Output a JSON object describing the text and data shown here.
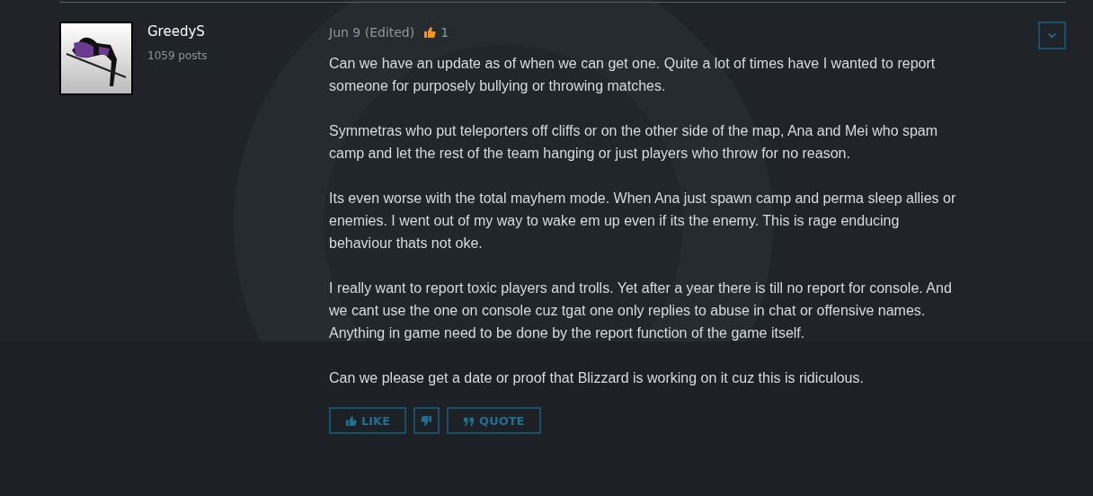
{
  "author": {
    "name": "GreedyS",
    "post_count": "1059 posts"
  },
  "post": {
    "date": "Jun 9 (Edited)",
    "likes": "1",
    "paragraphs": [
      "Can we have an update as of when we can get one. Quite a lot of times have I wanted to report someone for purposely bullying or throwing matches.",
      "Symmetras who put teleporters off cliffs or on the other side of the map, Ana and Mei who spam camp and let the rest of the team hanging or just players who throw for no reason.",
      "Its even worse with the total mayhem mode. When Ana just spawn camp and perma sleep allies or enemies. I went out of my way to wake em up even if its the enemy. This is rage enducing behaviour thats not oke.",
      "I really want to report toxic players and trolls. Yet after a year there is till no report for console. And we cant use the one on console cuz tgat one only replies to abuse in chat or offensive names. Anything in game need to be done by the report function of the game itself.",
      "Can we please get a date or proof that Blizzard is working on it cuz this is ridiculous."
    ]
  },
  "actions": [
    {
      "kind": "like",
      "label": "LIKE"
    },
    {
      "kind": "dislike"
    },
    {
      "kind": "quote",
      "label": "QUOTE"
    }
  ]
}
